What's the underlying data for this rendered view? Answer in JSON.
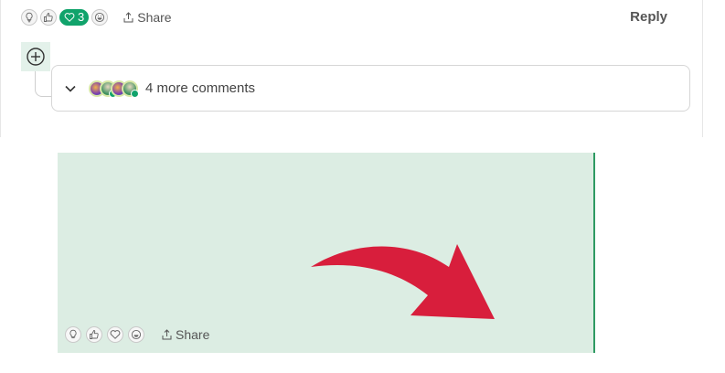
{
  "comment": {
    "reactions": [
      {
        "name": "insightful",
        "icon": "lightbulb-icon",
        "active": false
      },
      {
        "name": "like",
        "icon": "thumbs-up-icon",
        "active": false
      },
      {
        "name": "love",
        "icon": "heart-icon",
        "active": true,
        "count": "3"
      },
      {
        "name": "funny",
        "icon": "laugh-icon",
        "active": false
      }
    ],
    "share_label": "Share",
    "reply_label": "Reply",
    "more_comments_label": "4 more comments",
    "accent_color": "#10a36b"
  },
  "image_panel": {
    "background_color": "#dcede3",
    "arrow_color": "#d81e3c",
    "share_label": "Share",
    "reactions": [
      {
        "name": "insightful",
        "icon": "lightbulb-icon"
      },
      {
        "name": "like",
        "icon": "thumbs-up-icon"
      },
      {
        "name": "love",
        "icon": "heart-icon"
      },
      {
        "name": "funny",
        "icon": "laugh-icon"
      }
    ]
  }
}
